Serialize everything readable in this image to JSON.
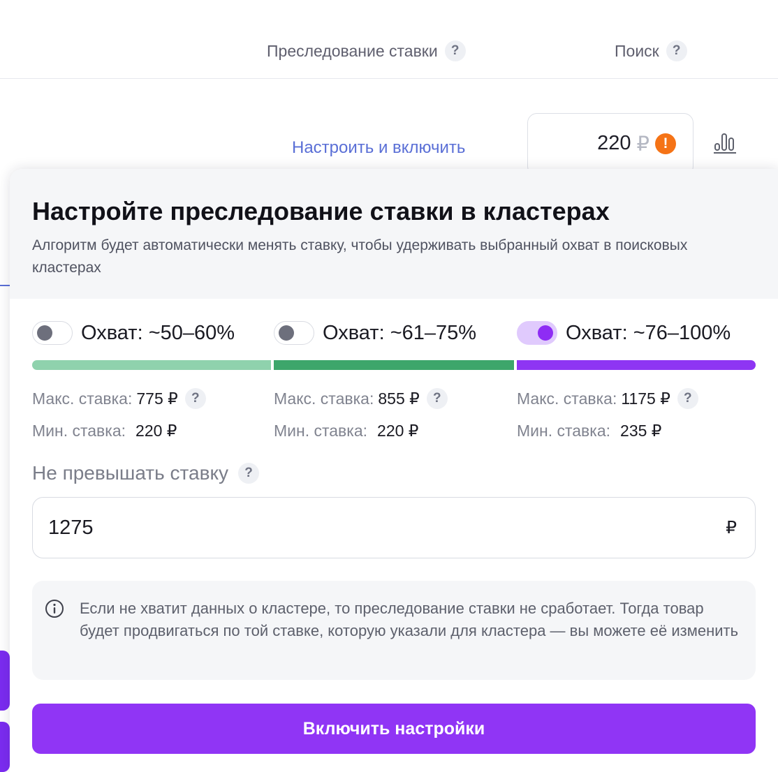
{
  "table_header": {
    "col_bid_tracking": "Преследование ставки",
    "col_search": "Поиск",
    "help": "?"
  },
  "row": {
    "configure_link": "Настроить и включить",
    "bid_value": "220",
    "bid_currency": "₽",
    "warning_symbol": "!"
  },
  "popover": {
    "title": "Настройте преследование ставки в кластерах",
    "subtitle": "Алгоритм будет автоматически менять ставку, чтобы удерживать выбранный охват в поисковых кластерах",
    "coverage_options": [
      {
        "label": "Охват: ~50–60%",
        "enabled": false,
        "bar_color": "#8fd2ad",
        "max_label": "Макс. ставка:",
        "max_value": "775 ₽",
        "min_label": "Мин. ставка:",
        "min_value": "220 ₽"
      },
      {
        "label": "Охват: ~61–75%",
        "enabled": false,
        "bar_color": "#3da66b",
        "max_label": "Макс. ставка:",
        "max_value": "855 ₽",
        "min_label": "Мин. ставка:",
        "min_value": "220 ₽"
      },
      {
        "label": "Охват: ~76–100%",
        "enabled": true,
        "bar_color": "#8e35f3",
        "max_label": "Макс. ставка:",
        "max_value": "1175 ₽",
        "min_label": "Мин. ставка:",
        "min_value": "235 ₽"
      }
    ],
    "help": "?",
    "limit_label": "Не превышать ставку",
    "limit_value": "1275",
    "limit_currency": "₽",
    "info_text": "Если не хватит данных о кластере, то преследование ставки не сработает. Тогда товар будет продвигаться по той ставке, которую указали для кластера — вы можете её изменить",
    "enable_button": "Включить настройки"
  },
  "colors": {
    "accent": "#9035f5",
    "link": "#5a6fd6",
    "warning": "#f57316"
  }
}
